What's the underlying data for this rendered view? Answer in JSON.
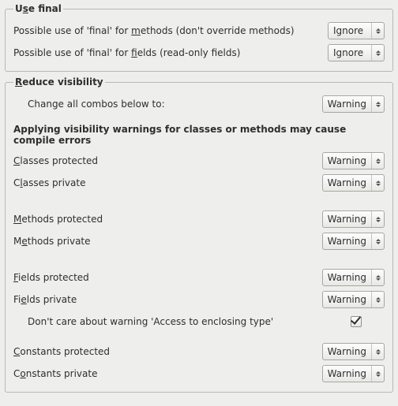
{
  "use_final": {
    "legend_pre": "U",
    "legend_mn": "s",
    "legend_post": "e final",
    "methods": {
      "pre": "Possible use of 'final' for ",
      "mn": "m",
      "post": "ethods (don't override methods)",
      "value": "Ignore"
    },
    "fields": {
      "pre": "Possible use of 'final' for ",
      "mn": "f",
      "post": "ields (read-only fields)",
      "value": "Ignore"
    }
  },
  "reduce": {
    "legend_pre": "",
    "legend_mn": "R",
    "legend_post": "educe visibility",
    "change_all": {
      "label": "Change all combos below to:",
      "value": "Warning"
    },
    "warning_heading": "Applying visibility warnings for classes or methods may cause compile errors",
    "classes_protected": {
      "pre": "",
      "mn": "C",
      "post": "lasses protected",
      "value": "Warning"
    },
    "classes_private": {
      "pre": "C",
      "mn": "l",
      "post": "asses private",
      "value": "Warning"
    },
    "methods_protected": {
      "pre": "",
      "mn": "M",
      "post": "ethods protected",
      "value": "Warning"
    },
    "methods_private": {
      "pre": "M",
      "mn": "e",
      "post": "thods private",
      "value": "Warning"
    },
    "fields_protected": {
      "pre": "",
      "mn": "F",
      "post": "ields protected",
      "value": "Warning"
    },
    "fields_private": {
      "pre": "Fi",
      "mn": "e",
      "post": "lds private",
      "value": "Warning"
    },
    "dont_care": {
      "label": "Don't care about warning 'Access to enclosing type'",
      "checked": true
    },
    "constants_protected": {
      "pre": "",
      "mn": "C",
      "post": "onstants protected",
      "value": "Warning"
    },
    "constants_private": {
      "pre": "C",
      "mn": "o",
      "post": "nstants private",
      "value": "Warning"
    }
  }
}
